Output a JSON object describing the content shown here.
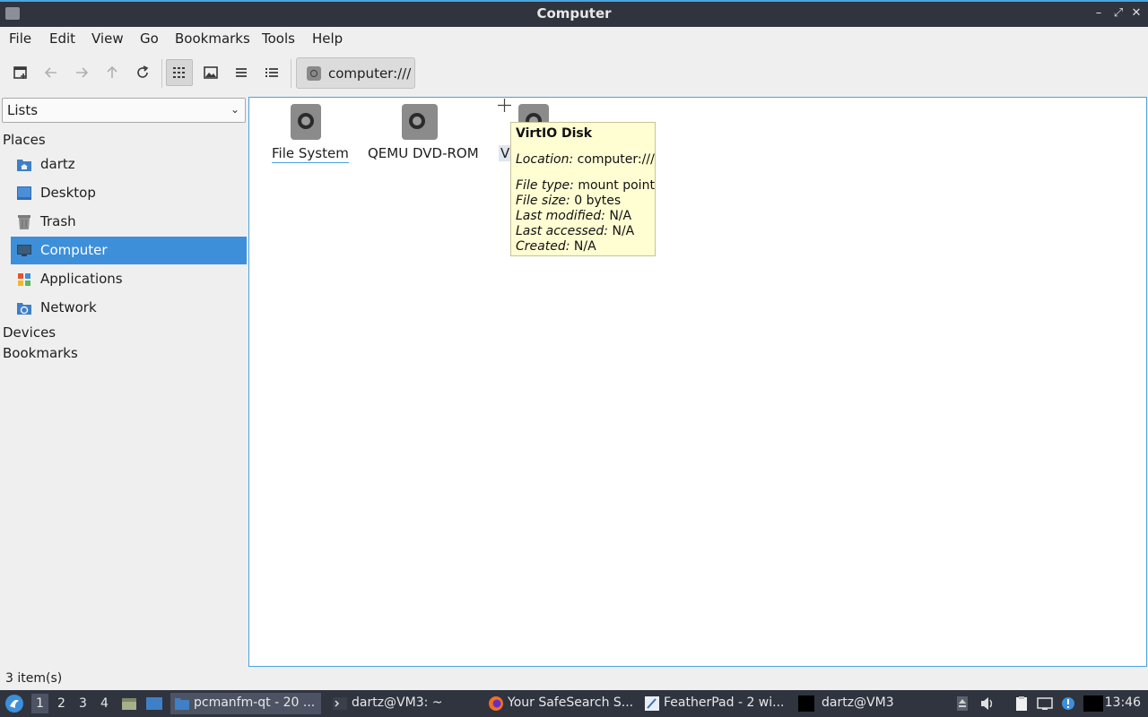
{
  "window": {
    "title": "Computer"
  },
  "menu": {
    "file": "File",
    "edit": "Edit",
    "view": "View",
    "go": "Go",
    "bookmarks": "Bookmarks",
    "tools": "Tools",
    "help": "Help"
  },
  "path": {
    "value": "computer:///"
  },
  "sidepane": {
    "mode": "Lists",
    "places_header": "Places",
    "places": [
      {
        "label": "dartz",
        "icon": "home-folder-icon"
      },
      {
        "label": "Desktop",
        "icon": "desktop-icon"
      },
      {
        "label": "Trash",
        "icon": "trash-icon"
      },
      {
        "label": "Computer",
        "icon": "computer-icon",
        "selected": true
      },
      {
        "label": "Applications",
        "icon": "applications-icon"
      },
      {
        "label": "Network",
        "icon": "network-icon"
      }
    ],
    "devices_header": "Devices",
    "bookmarks_header": "Bookmarks"
  },
  "items": [
    {
      "label": "File System",
      "icon": "drive-icon"
    },
    {
      "label": "QEMU DVD-ROM",
      "icon": "optical-drive-icon"
    },
    {
      "label": "V",
      "icon": "drive-icon"
    }
  ],
  "tooltip": {
    "title": "VirtIO Disk",
    "location_key": "Location:",
    "location_val": "computer:///",
    "type_key": "File type:",
    "type_val": "mount point",
    "size_key": "File size:",
    "size_val": "0 bytes",
    "modified_key": "Last modified:",
    "modified_val": "N/A",
    "accessed_key": "Last accessed:",
    "accessed_val": "N/A",
    "created_key": "Created:",
    "created_val": "N/A"
  },
  "status": {
    "text": "3 item(s)"
  },
  "taskbar": {
    "workspaces": [
      "1",
      "2",
      "3",
      "4"
    ],
    "tasks": [
      {
        "label": "pcmanfm-qt - 20 ...",
        "icon": "folder-icon"
      },
      {
        "label": "dartz@VM3: ~",
        "icon": "terminal-icon"
      },
      {
        "label": "Your SafeSearch S...",
        "icon": "firefox-icon"
      },
      {
        "label": "FeatherPad - 2 wi...",
        "icon": "featherpad-icon"
      },
      {
        "label": "dartz@VM3",
        "icon": "terminal-icon"
      }
    ],
    "clock": "13:46"
  },
  "colors": {
    "accent": "#3d8fd9",
    "titlebar": "#2f343f",
    "tooltip_bg": "#fffdd2"
  }
}
